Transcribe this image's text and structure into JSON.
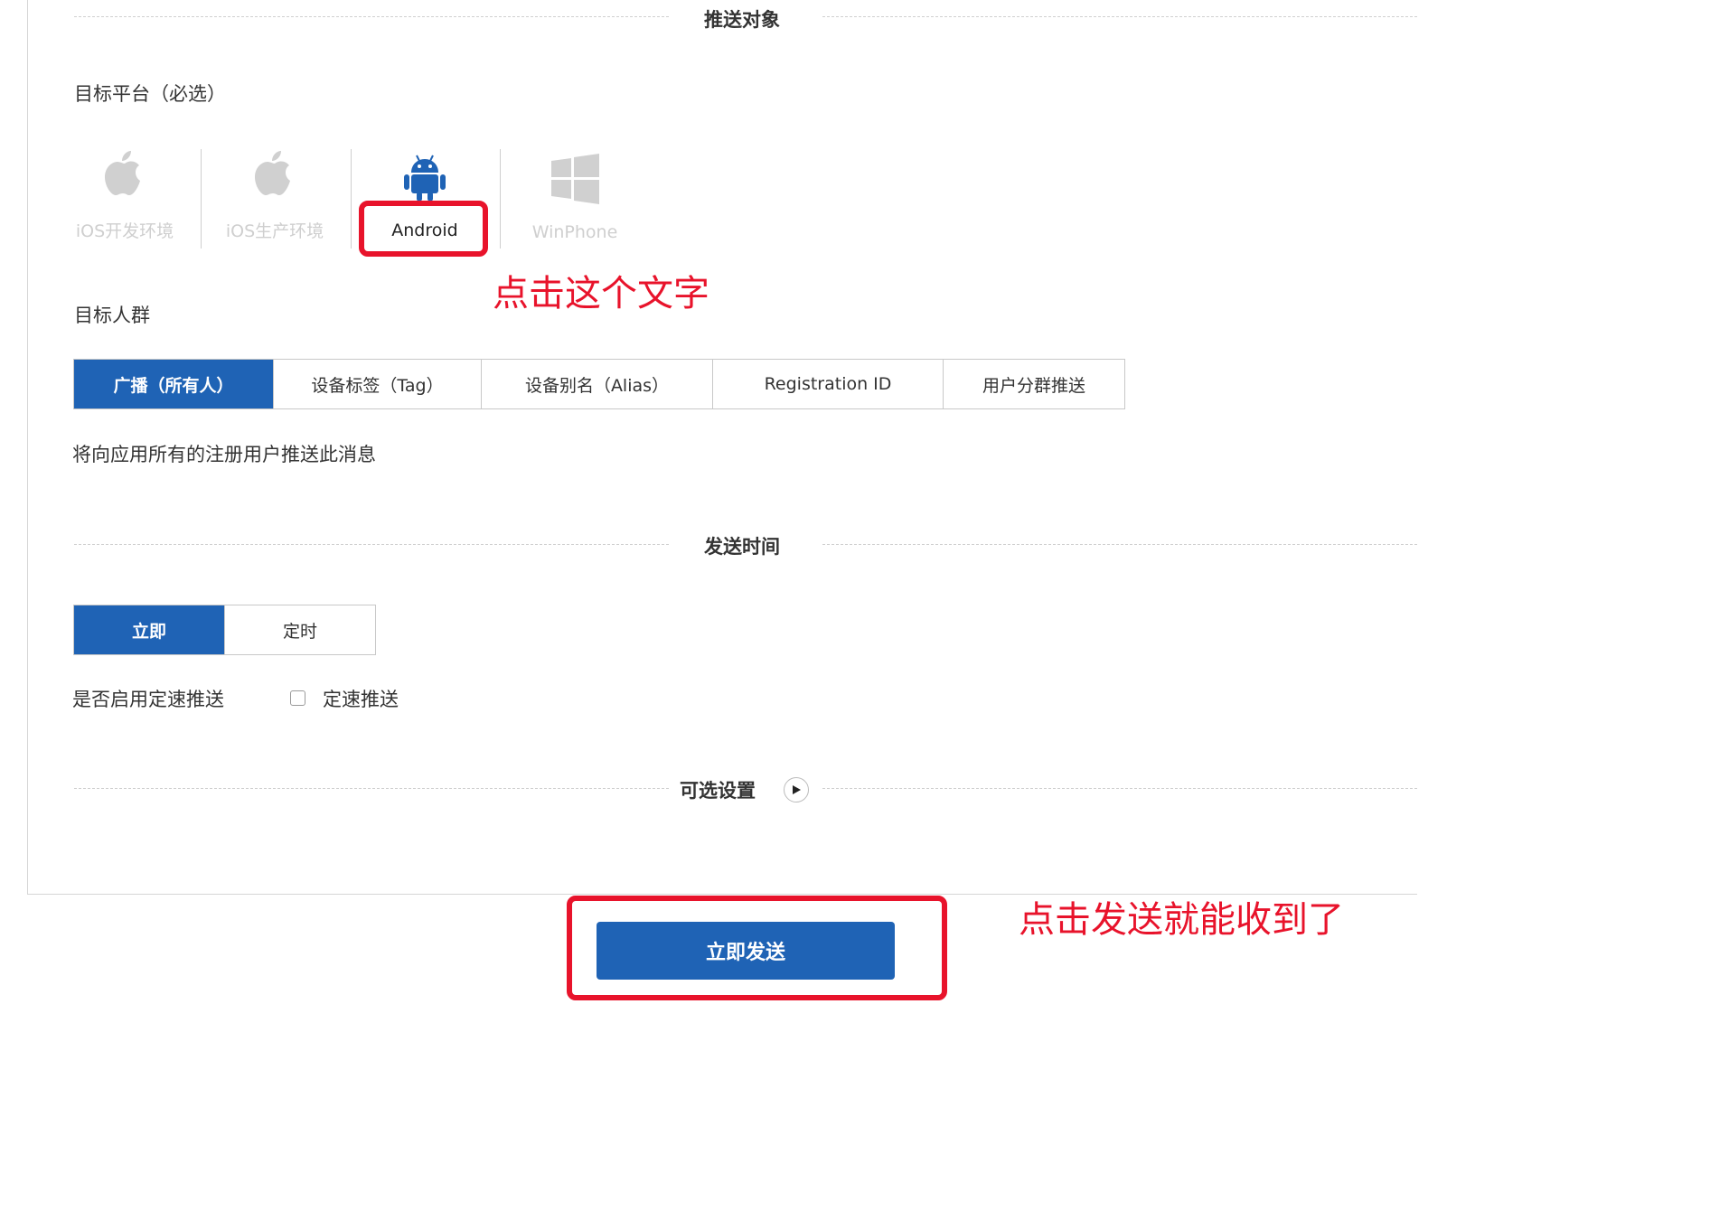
{
  "sections": {
    "push_target": "推送对象",
    "send_time": "发送时间",
    "optional": "可选设置"
  },
  "target_platform": {
    "label": "目标平台（必选）",
    "items": [
      {
        "name": "iOS开发环境",
        "icon": "apple-icon",
        "active": false
      },
      {
        "name": "iOS生产环境",
        "icon": "apple-icon",
        "active": false
      },
      {
        "name": "Android",
        "icon": "android-icon",
        "active": true
      },
      {
        "name": "WinPhone",
        "icon": "windows-icon",
        "active": false
      }
    ]
  },
  "target_audience": {
    "label": "目标人群",
    "options": [
      "广播（所有人）",
      "设备标签（Tag）",
      "设备别名（Alias）",
      "Registration ID",
      "用户分群推送"
    ],
    "selected": "广播（所有人）",
    "description": "将向应用所有的注册用户推送此消息"
  },
  "send_time": {
    "options": [
      "立即",
      "定时"
    ],
    "selected": "立即"
  },
  "rate_limit": {
    "label": "是否启用定速推送",
    "checkbox_label": "定速推送",
    "checked": false
  },
  "send_button": "立即发送",
  "annotations": {
    "click_text": "点击这个文字",
    "click_send": "点击发送就能收到了"
  },
  "colors": {
    "primary": "#1f63b5",
    "annotation_red": "#e8132b",
    "inactive_icon": "#d0d0d0"
  }
}
